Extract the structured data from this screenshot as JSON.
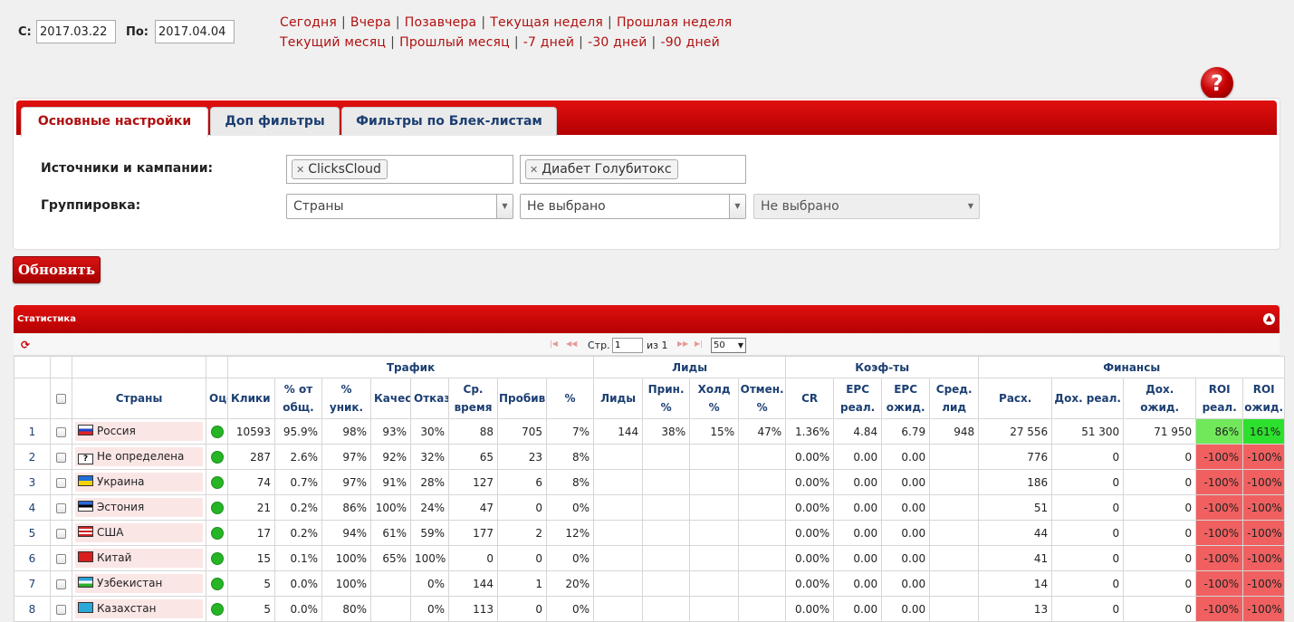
{
  "dates": {
    "from_label": "С:",
    "from_value": "2017.03.22",
    "to_label": "По:",
    "to_value": "2017.04.04"
  },
  "quick_links": [
    "Сегодня",
    "Вчера",
    "Позавчера",
    "Текущая неделя",
    "Прошлая неделя",
    "Текущий месяц",
    "Прошлый месяц",
    "-7 дней",
    "-30 дней",
    "-90 дней"
  ],
  "help": {
    "icon": "question-icon",
    "glyph": "?"
  },
  "tabs": [
    {
      "label": "Основные настройки",
      "active": true
    },
    {
      "label": "Доп фильтры",
      "active": false
    },
    {
      "label": "Фильтры по Блек-листам",
      "active": false
    }
  ],
  "form": {
    "sources_label": "Источники и кампании:",
    "sources_tag": "ClicksCloud",
    "campaigns_tag": "Диабет Голубитокс",
    "grouping_label": "Группировка:",
    "group1": "Страны",
    "group2": "Не выбрано",
    "group3": "Не выбрано"
  },
  "refresh_label": "Обновить",
  "grid": {
    "caption": "Статистика",
    "pager": {
      "page_label": "Стр.",
      "page_value": "1",
      "of_label": "из 1",
      "rows": "50"
    },
    "groups": {
      "traffic": "Трафик",
      "leads": "Лиды",
      "coef": "Коэф-ты",
      "finance": "Финансы"
    },
    "columns": [
      "Страны",
      "Оце",
      "Клики",
      "% от общ.",
      "% уник.",
      "Качест",
      "Отказ",
      "Ср. время",
      "Пробив",
      "%",
      "Лиды",
      "Прин. %",
      "Холд %",
      "Отмен. %",
      "CR",
      "EPC реал.",
      "EPC ожид.",
      "Сред. лид",
      "Расх.",
      "Дох. реал.",
      "Дох. ожид.",
      "ROI реал.",
      "ROI ожид."
    ],
    "rows": [
      {
        "n": "1",
        "country": "Россия",
        "flag": "russia",
        "clicks": "10593",
        "pct_total": "95.9%",
        "pct_uniq": "98%",
        "quality": "93%",
        "bounce": "30%",
        "avg_time": "88",
        "probe": "705",
        "pct": "7%",
        "leads": "144",
        "acc": "38%",
        "hold": "15%",
        "cancel": "47%",
        "cr": "1.36%",
        "epc_r": "4.84",
        "epc_e": "6.79",
        "avg_lead": "948",
        "cost": "27 556",
        "inc_r": "51 300",
        "inc_e": "71 950",
        "roi_r": "86%",
        "roi_e": "161%"
      },
      {
        "n": "2",
        "country": "Не определена",
        "flag": "unknown",
        "clicks": "287",
        "pct_total": "2.6%",
        "pct_uniq": "97%",
        "quality": "92%",
        "bounce": "32%",
        "avg_time": "65",
        "probe": "23",
        "pct": "8%",
        "leads": "",
        "acc": "",
        "hold": "",
        "cancel": "",
        "cr": "0.00%",
        "epc_r": "0.00",
        "epc_e": "0.00",
        "avg_lead": "",
        "cost": "776",
        "inc_r": "0",
        "inc_e": "0",
        "roi_r": "-100%",
        "roi_e": "-100%"
      },
      {
        "n": "3",
        "country": "Украина",
        "flag": "ukraine",
        "clicks": "74",
        "pct_total": "0.7%",
        "pct_uniq": "97%",
        "quality": "91%",
        "bounce": "28%",
        "avg_time": "127",
        "probe": "6",
        "pct": "8%",
        "leads": "",
        "acc": "",
        "hold": "",
        "cancel": "",
        "cr": "0.00%",
        "epc_r": "0.00",
        "epc_e": "0.00",
        "avg_lead": "",
        "cost": "186",
        "inc_r": "0",
        "inc_e": "0",
        "roi_r": "-100%",
        "roi_e": "-100%"
      },
      {
        "n": "4",
        "country": "Эстония",
        "flag": "estonia",
        "clicks": "21",
        "pct_total": "0.2%",
        "pct_uniq": "86%",
        "quality": "100%",
        "bounce": "24%",
        "avg_time": "47",
        "probe": "0",
        "pct": "0%",
        "leads": "",
        "acc": "",
        "hold": "",
        "cancel": "",
        "cr": "0.00%",
        "epc_r": "0.00",
        "epc_e": "0.00",
        "avg_lead": "",
        "cost": "51",
        "inc_r": "0",
        "inc_e": "0",
        "roi_r": "-100%",
        "roi_e": "-100%"
      },
      {
        "n": "5",
        "country": "США",
        "flag": "usa",
        "clicks": "17",
        "pct_total": "0.2%",
        "pct_uniq": "94%",
        "quality": "61%",
        "bounce": "59%",
        "avg_time": "177",
        "probe": "2",
        "pct": "12%",
        "leads": "",
        "acc": "",
        "hold": "",
        "cancel": "",
        "cr": "0.00%",
        "epc_r": "0.00",
        "epc_e": "0.00",
        "avg_lead": "",
        "cost": "44",
        "inc_r": "0",
        "inc_e": "0",
        "roi_r": "-100%",
        "roi_e": "-100%"
      },
      {
        "n": "6",
        "country": "Китай",
        "flag": "china",
        "clicks": "15",
        "pct_total": "0.1%",
        "pct_uniq": "100%",
        "quality": "65%",
        "bounce": "100%",
        "avg_time": "0",
        "probe": "0",
        "pct": "0%",
        "leads": "",
        "acc": "",
        "hold": "",
        "cancel": "",
        "cr": "0.00%",
        "epc_r": "0.00",
        "epc_e": "0.00",
        "avg_lead": "",
        "cost": "41",
        "inc_r": "0",
        "inc_e": "0",
        "roi_r": "-100%",
        "roi_e": "-100%"
      },
      {
        "n": "7",
        "country": "Узбекистан",
        "flag": "uzbekistan",
        "clicks": "5",
        "pct_total": "0.0%",
        "pct_uniq": "100%",
        "quality": "",
        "bounce": "0%",
        "avg_time": "144",
        "probe": "1",
        "pct": "20%",
        "leads": "",
        "acc": "",
        "hold": "",
        "cancel": "",
        "cr": "0.00%",
        "epc_r": "0.00",
        "epc_e": "0.00",
        "avg_lead": "",
        "cost": "14",
        "inc_r": "0",
        "inc_e": "0",
        "roi_r": "-100%",
        "roi_e": "-100%"
      },
      {
        "n": "8",
        "country": "Казахстан",
        "flag": "kazakhstan",
        "clicks": "5",
        "pct_total": "0.0%",
        "pct_uniq": "80%",
        "quality": "",
        "bounce": "0%",
        "avg_time": "113",
        "probe": "0",
        "pct": "0%",
        "leads": "",
        "acc": "",
        "hold": "",
        "cancel": "",
        "cr": "0.00%",
        "epc_r": "0.00",
        "epc_e": "0.00",
        "avg_lead": "",
        "cost": "13",
        "inc_r": "0",
        "inc_e": "0",
        "roi_r": "-100%",
        "roi_e": "-100%"
      }
    ]
  },
  "colors": {
    "accent": "#c40000",
    "link": "#b01010",
    "header_text": "#1c3f72",
    "roi_negative": "#f06060",
    "roi_positive": "#2ee02e",
    "status_dot": "#25b525"
  }
}
